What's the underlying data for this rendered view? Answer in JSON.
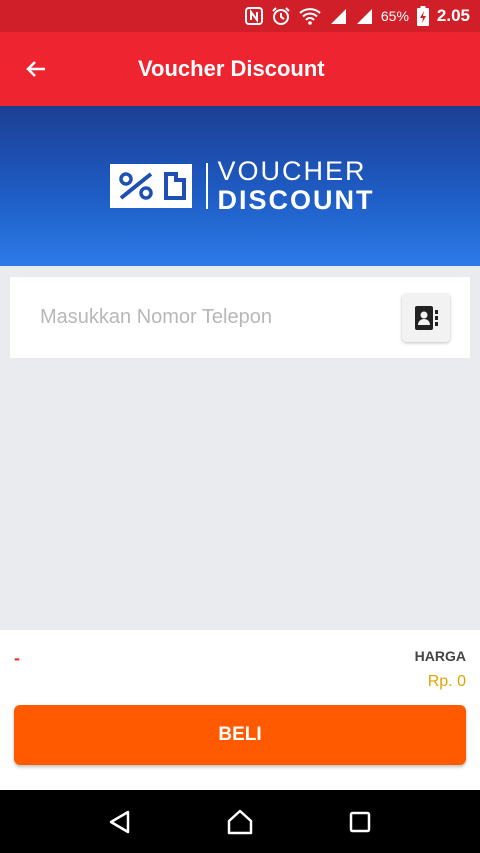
{
  "status_bar": {
    "battery_percent": "65%",
    "time": "2.05",
    "icons": [
      "nfc-icon",
      "alarm-icon",
      "wifi-icon",
      "signal-icon",
      "signal-icon",
      "battery-charging-icon"
    ]
  },
  "app_bar": {
    "title": "Voucher Discount",
    "back_icon": "arrow-left-icon",
    "color": "#ee2530"
  },
  "banner": {
    "logo_line1": "VOUCHER",
    "logo_line2": "DISCOUNT"
  },
  "phone_input": {
    "placeholder": "Masukkan Nomor Telepon",
    "value": "",
    "contact_icon": "contact-book-icon"
  },
  "summary": {
    "product": "-",
    "price_label": "HARGA",
    "price_value": "Rp. 0"
  },
  "buy_button": {
    "label": "BELI",
    "color": "#ff5a00"
  },
  "nav_bar": {
    "icons": [
      "back-triangle-icon",
      "home-icon",
      "recents-square-icon"
    ]
  }
}
